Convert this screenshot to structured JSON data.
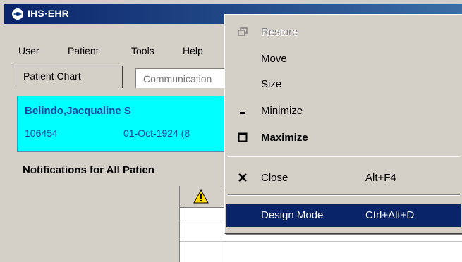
{
  "window": {
    "title": "IHS·EHR"
  },
  "menubar": {
    "items": [
      "User",
      "Patient",
      "Tools",
      "Help"
    ]
  },
  "tabs": {
    "items": [
      "Patient Chart",
      "Communication"
    ]
  },
  "patient": {
    "name": "Belindo,Jacqualine S",
    "id": "106454",
    "dob": "01-Oct-1924  (8"
  },
  "notifications": {
    "title": "Notifications for All Patien"
  },
  "system_menu": {
    "items": [
      {
        "label": "Restore",
        "icon": "restore-icon",
        "accel": "",
        "state": "disabled"
      },
      {
        "label": "Move",
        "icon": "",
        "accel": "",
        "state": "normal"
      },
      {
        "label": "Size",
        "icon": "",
        "accel": "",
        "state": "normal"
      },
      {
        "label": "Minimize",
        "icon": "minimize-icon",
        "accel": "",
        "state": "normal"
      },
      {
        "label": "Maximize",
        "icon": "maximize-icon",
        "accel": "",
        "state": "default"
      },
      {
        "label": "Close",
        "icon": "close-icon",
        "accel": "Alt+F4",
        "state": "normal"
      },
      {
        "label": "Design Mode",
        "icon": "",
        "accel": "Ctrl+Alt+D",
        "state": "highlighted"
      }
    ]
  },
  "colors": {
    "title_bar": "#0a246a",
    "highlight": "#0a246a",
    "patient_banner": "#00ffff",
    "patient_text": "#1f3fa1"
  }
}
